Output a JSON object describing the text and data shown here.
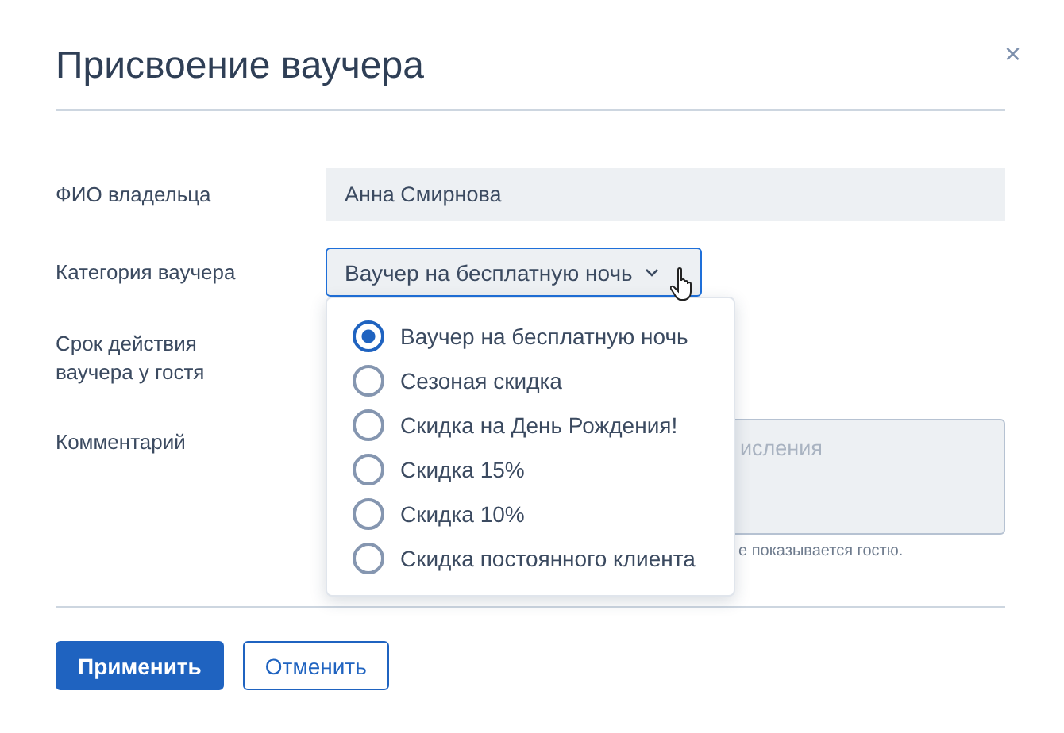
{
  "dialog": {
    "title": "Присвоение ваучера",
    "close": "×"
  },
  "fields": [
    {
      "kind": "text",
      "label": "ФИО владельца",
      "value": "Анна Смирнова"
    },
    {
      "kind": "select",
      "label": "Категория ваучера",
      "value": "Ваучер на бесплатную ночь",
      "expanded": true
    },
    {
      "kind": "blank",
      "label": "Срок действия ваучера у гостя"
    },
    {
      "kind": "textarea",
      "label": "Комментарий",
      "placeholder": "исления",
      "hint": "е показывается гостю."
    }
  ],
  "menu": [
    {
      "label": "Ваучер на бесплатную ночь",
      "selected": true
    },
    {
      "label": "Сезоная скидка",
      "selected": false
    },
    {
      "label": "Скидка на День Рождения!",
      "selected": false
    },
    {
      "label": "Скидка 15%",
      "selected": false
    },
    {
      "label": "Скидка 10%",
      "selected": false
    },
    {
      "label": "Скидка постоянного клиента",
      "selected": false
    }
  ],
  "buttons": [
    {
      "label": "Применить",
      "kind": "primary"
    },
    {
      "label": "Отменить",
      "kind": "secondary"
    }
  ]
}
